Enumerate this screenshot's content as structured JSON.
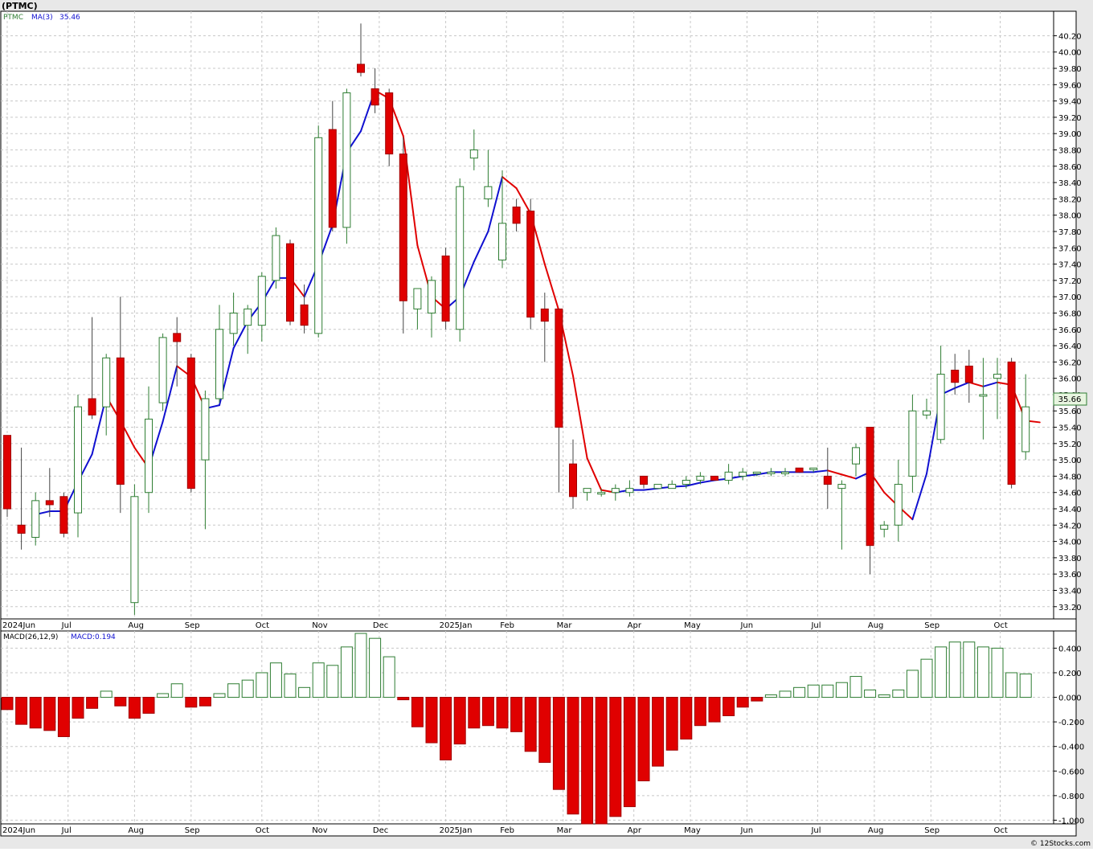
{
  "title": "(PTMC)",
  "footer": "© 12Stocks.com",
  "colors": {
    "up": "#2e7d32",
    "down": "#e00000",
    "ma_up": "#1010d0",
    "ma_down": "#e00000",
    "grid": "#c8c8c8",
    "panel_bg": "#ffffff",
    "page_bg": "#e8e8e8"
  },
  "chart_data": [
    {
      "type": "candlestick",
      "title": "",
      "legend": {
        "ticker": "PTMC",
        "ma_label": "MA(3)",
        "ma_value": "35.46"
      },
      "last_price_label": "35.66",
      "ylim": [
        33.05,
        40.5
      ],
      "yticks": [
        "33.20",
        "33.40",
        "33.60",
        "33.80",
        "34.00",
        "34.20",
        "34.40",
        "34.60",
        "34.80",
        "35.00",
        "35.20",
        "35.40",
        "35.60",
        "35.80",
        "36.00",
        "36.20",
        "36.40",
        "36.60",
        "36.80",
        "37.00",
        "37.20",
        "37.40",
        "37.60",
        "37.80",
        "38.00",
        "38.20",
        "38.40",
        "38.60",
        "38.80",
        "39.00",
        "39.20",
        "39.40",
        "39.60",
        "39.80",
        "40.00",
        "40.20"
      ],
      "xticks": [
        {
          "label": "2024Jun",
          "i": 0
        },
        {
          "label": "Jul",
          "i": 4.3
        },
        {
          "label": "Aug",
          "i": 9
        },
        {
          "label": "Sep",
          "i": 13
        },
        {
          "label": "Oct",
          "i": 18
        },
        {
          "label": "Nov",
          "i": 22
        },
        {
          "label": "Dec",
          "i": 26.3
        },
        {
          "label": "2025Jan",
          "i": 31
        },
        {
          "label": "Feb",
          "i": 35.3
        },
        {
          "label": "Mar",
          "i": 39.3
        },
        {
          "label": "Apr",
          "i": 44.3
        },
        {
          "label": "May",
          "i": 48.3
        },
        {
          "label": "Jun",
          "i": 52.3
        },
        {
          "label": "Jul",
          "i": 57.3
        },
        {
          "label": "Aug",
          "i": 61.3
        },
        {
          "label": "Sep",
          "i": 65.3
        },
        {
          "label": "Oct",
          "i": 70.2
        }
      ],
      "candles": [
        {
          "o": 35.3,
          "h": 35.3,
          "l": 34.3,
          "c": 34.4
        },
        {
          "o": 34.2,
          "h": 35.15,
          "l": 33.9,
          "c": 34.1
        },
        {
          "o": 34.05,
          "h": 34.6,
          "l": 33.95,
          "c": 34.5
        },
        {
          "o": 34.5,
          "h": 34.9,
          "l": 34.3,
          "c": 34.45
        },
        {
          "o": 34.55,
          "h": 34.6,
          "l": 34.05,
          "c": 34.1
        },
        {
          "o": 34.35,
          "h": 35.8,
          "l": 34.05,
          "c": 35.65
        },
        {
          "o": 35.75,
          "h": 36.75,
          "l": 35.5,
          "c": 35.55
        },
        {
          "o": 35.65,
          "h": 36.3,
          "l": 35.3,
          "c": 36.25
        },
        {
          "o": 36.25,
          "h": 37.0,
          "l": 34.35,
          "c": 34.7
        },
        {
          "o": 33.25,
          "h": 34.7,
          "l": 33.1,
          "c": 34.55
        },
        {
          "o": 34.6,
          "h": 35.9,
          "l": 34.35,
          "c": 35.5
        },
        {
          "o": 35.7,
          "h": 36.55,
          "l": 35.6,
          "c": 36.5
        },
        {
          "o": 36.55,
          "h": 36.75,
          "l": 35.9,
          "c": 36.45
        },
        {
          "o": 36.25,
          "h": 36.3,
          "l": 34.6,
          "c": 34.65
        },
        {
          "o": 35.0,
          "h": 35.85,
          "l": 34.15,
          "c": 35.75
        },
        {
          "o": 35.75,
          "h": 36.9,
          "l": 35.7,
          "c": 36.6
        },
        {
          "o": 36.55,
          "h": 37.05,
          "l": 36.4,
          "c": 36.8
        },
        {
          "o": 36.65,
          "h": 36.9,
          "l": 36.3,
          "c": 36.85
        },
        {
          "o": 36.65,
          "h": 37.3,
          "l": 36.45,
          "c": 37.25
        },
        {
          "o": 37.2,
          "h": 37.85,
          "l": 37.1,
          "c": 37.75
        },
        {
          "o": 37.65,
          "h": 37.7,
          "l": 36.65,
          "c": 36.7
        },
        {
          "o": 36.9,
          "h": 37.15,
          "l": 36.55,
          "c": 36.65
        },
        {
          "o": 36.55,
          "h": 39.1,
          "l": 36.5,
          "c": 38.95
        },
        {
          "o": 39.05,
          "h": 39.4,
          "l": 37.8,
          "c": 37.85
        },
        {
          "o": 37.85,
          "h": 39.55,
          "l": 37.65,
          "c": 39.5
        },
        {
          "o": 39.85,
          "h": 40.35,
          "l": 39.7,
          "c": 39.75
        },
        {
          "o": 39.55,
          "h": 39.8,
          "l": 39.25,
          "c": 39.35
        },
        {
          "o": 39.5,
          "h": 39.55,
          "l": 38.6,
          "c": 38.75
        },
        {
          "o": 38.75,
          "h": 38.95,
          "l": 36.55,
          "c": 36.95
        },
        {
          "o": 36.85,
          "h": 37.05,
          "l": 36.6,
          "c": 37.1
        },
        {
          "o": 36.8,
          "h": 37.25,
          "l": 36.5,
          "c": 37.2
        },
        {
          "o": 37.5,
          "h": 37.6,
          "l": 36.6,
          "c": 36.7
        },
        {
          "o": 36.6,
          "h": 38.45,
          "l": 36.45,
          "c": 38.35
        },
        {
          "o": 38.7,
          "h": 39.05,
          "l": 38.55,
          "c": 38.8
        },
        {
          "o": 38.2,
          "h": 38.8,
          "l": 38.1,
          "c": 38.35
        },
        {
          "o": 37.45,
          "h": 38.55,
          "l": 37.35,
          "c": 37.9
        },
        {
          "o": 38.1,
          "h": 38.2,
          "l": 37.8,
          "c": 37.9
        },
        {
          "o": 38.05,
          "h": 38.2,
          "l": 36.6,
          "c": 36.75
        },
        {
          "o": 36.85,
          "h": 37.05,
          "l": 36.2,
          "c": 36.7
        },
        {
          "o": 36.85,
          "h": 36.85,
          "l": 34.6,
          "c": 35.4
        },
        {
          "o": 34.95,
          "h": 35.25,
          "l": 34.4,
          "c": 34.55
        },
        {
          "o": 34.6,
          "h": 34.65,
          "l": 34.5,
          "c": 34.65
        },
        {
          "o": 34.6,
          "h": 34.65,
          "l": 34.55,
          "c": 34.6
        },
        {
          "o": 34.6,
          "h": 34.7,
          "l": 34.5,
          "c": 34.65
        },
        {
          "o": 34.6,
          "h": 34.75,
          "l": 34.55,
          "c": 34.65
        },
        {
          "o": 34.8,
          "h": 34.8,
          "l": 34.65,
          "c": 34.7
        },
        {
          "o": 34.65,
          "h": 34.7,
          "l": 34.65,
          "c": 34.7
        },
        {
          "o": 34.65,
          "h": 34.75,
          "l": 34.65,
          "c": 34.7
        },
        {
          "o": 34.7,
          "h": 34.8,
          "l": 34.65,
          "c": 34.75
        },
        {
          "o": 34.75,
          "h": 34.85,
          "l": 34.7,
          "c": 34.8
        },
        {
          "o": 34.8,
          "h": 34.8,
          "l": 34.75,
          "c": 34.75
        },
        {
          "o": 34.75,
          "h": 34.95,
          "l": 34.7,
          "c": 34.85
        },
        {
          "o": 34.8,
          "h": 34.9,
          "l": 34.75,
          "c": 34.85
        },
        {
          "o": 34.85,
          "h": 34.85,
          "l": 34.8,
          "c": 34.85
        },
        {
          "o": 34.85,
          "h": 34.9,
          "l": 34.8,
          "c": 34.85
        },
        {
          "o": 34.85,
          "h": 34.9,
          "l": 34.8,
          "c": 34.85
        },
        {
          "o": 34.9,
          "h": 34.9,
          "l": 34.85,
          "c": 34.85
        },
        {
          "o": 34.9,
          "h": 34.9,
          "l": 34.85,
          "c": 34.9
        },
        {
          "o": 34.8,
          "h": 35.15,
          "l": 34.4,
          "c": 34.7
        },
        {
          "o": 34.65,
          "h": 34.75,
          "l": 33.9,
          "c": 34.7
        },
        {
          "o": 34.95,
          "h": 35.2,
          "l": 34.8,
          "c": 35.15
        },
        {
          "o": 35.4,
          "h": 35.4,
          "l": 33.6,
          "c": 33.95
        },
        {
          "o": 34.15,
          "h": 34.25,
          "l": 34.05,
          "c": 34.2
        },
        {
          "o": 34.2,
          "h": 35.0,
          "l": 34.0,
          "c": 34.7
        },
        {
          "o": 34.8,
          "h": 35.8,
          "l": 34.6,
          "c": 35.6
        },
        {
          "o": 35.55,
          "h": 35.75,
          "l": 35.5,
          "c": 35.6
        },
        {
          "o": 35.25,
          "h": 36.4,
          "l": 35.2,
          "c": 36.05
        },
        {
          "o": 36.1,
          "h": 36.3,
          "l": 35.8,
          "c": 35.95
        },
        {
          "o": 36.15,
          "h": 36.35,
          "l": 35.7,
          "c": 35.95
        },
        {
          "o": 35.8,
          "h": 36.25,
          "l": 35.25,
          "c": 35.8
        },
        {
          "o": 36.0,
          "h": 36.25,
          "l": 35.5,
          "c": 36.05
        },
        {
          "o": 36.2,
          "h": 36.25,
          "l": 34.65,
          "c": 34.7
        },
        {
          "o": 35.1,
          "h": 36.05,
          "l": 35.0,
          "c": 35.65
        }
      ],
      "ma": {
        "start": 2,
        "values": [
          34.33,
          34.37,
          34.37,
          34.73,
          35.07,
          35.78,
          35.48,
          35.15,
          34.9,
          35.47,
          36.15,
          36.02,
          35.63,
          35.67,
          36.37,
          36.7,
          36.93,
          37.23,
          37.23,
          37.0,
          37.4,
          37.88,
          38.77,
          39.03,
          39.53,
          39.43,
          38.97,
          37.63,
          37.0,
          36.85,
          37.0,
          37.43,
          37.8,
          38.47,
          38.33,
          38.02,
          37.4,
          36.83,
          36.03,
          35.02,
          34.63,
          34.6,
          34.63,
          34.63,
          34.65,
          34.67,
          34.68,
          34.72,
          34.75,
          34.77,
          34.8,
          34.82,
          34.85,
          34.85,
          34.85,
          34.85,
          34.87,
          34.82,
          34.77,
          34.85,
          34.6,
          34.43,
          34.27,
          34.83,
          35.8,
          35.88,
          35.95,
          35.9,
          35.95,
          35.92,
          35.48,
          35.46
        ]
      }
    },
    {
      "type": "bar",
      "title": "",
      "legend": {
        "label": "MACD(26,12,9)",
        "value": "MACD:0.194"
      },
      "ylim": [
        -1.03,
        0.54
      ],
      "yticks": [
        "0.400",
        "0.200",
        "0.000",
        "-0.200",
        "-0.400",
        "-0.600",
        "-0.800",
        "-1.000"
      ],
      "values": [
        -0.1,
        -0.22,
        -0.25,
        -0.27,
        -0.32,
        -0.17,
        -0.09,
        0.05,
        -0.07,
        -0.17,
        -0.13,
        0.03,
        0.11,
        -0.08,
        -0.07,
        0.03,
        0.11,
        0.14,
        0.2,
        0.28,
        0.19,
        0.08,
        0.28,
        0.26,
        0.41,
        0.52,
        0.48,
        0.33,
        -0.02,
        -0.24,
        -0.37,
        -0.51,
        -0.38,
        -0.25,
        -0.23,
        -0.25,
        -0.28,
        -0.44,
        -0.53,
        -0.75,
        -0.95,
        -1.03,
        -1.03,
        -0.97,
        -0.89,
        -0.68,
        -0.56,
        -0.43,
        -0.34,
        -0.23,
        -0.2,
        -0.15,
        -0.08,
        -0.03,
        0.02,
        0.05,
        0.08,
        0.1,
        0.1,
        0.12,
        0.17,
        0.06,
        0.02,
        0.06,
        0.22,
        0.31,
        0.41,
        0.45,
        0.45,
        0.41,
        0.4,
        0.2,
        0.19
      ]
    }
  ]
}
